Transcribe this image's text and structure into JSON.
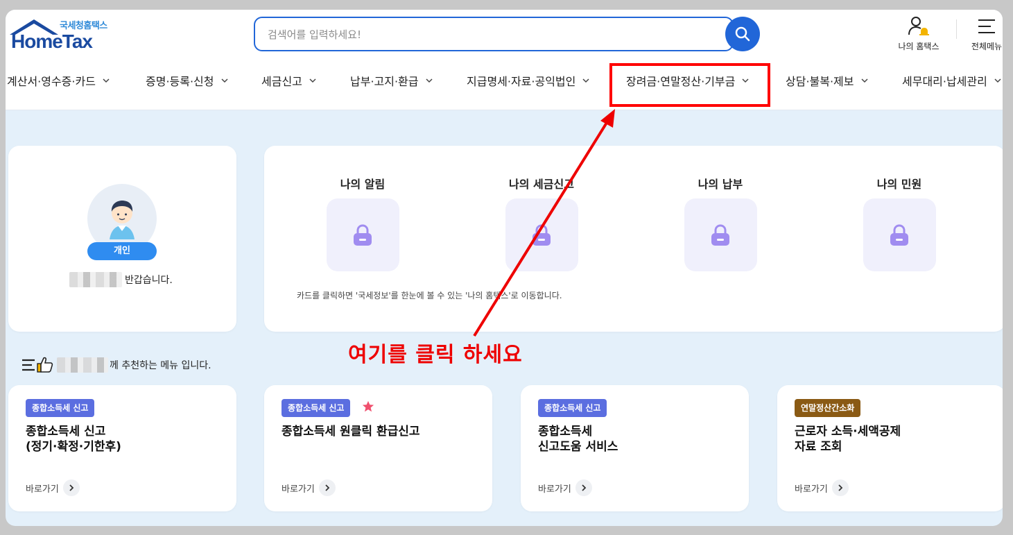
{
  "brand": {
    "small_text": "국세청홈택스",
    "name": "HomeTax"
  },
  "search": {
    "placeholder": "검색어를 입력하세요!"
  },
  "utility": {
    "my_hometax": "나의 홈택스",
    "all_menu": "전체메뉴"
  },
  "gnb": [
    {
      "label": "계산서·영수증·카드"
    },
    {
      "label": "증명·등록·신청"
    },
    {
      "label": "세금신고"
    },
    {
      "label": "납부·고지·환급"
    },
    {
      "label": "지급명세·자료·공익법인"
    },
    {
      "label": "장려금·연말정산·기부금"
    },
    {
      "label": "상담·불복·제보"
    },
    {
      "label": "세무대리·납세관리"
    }
  ],
  "profile": {
    "badge": "개인",
    "greeting": "반갑습니다."
  },
  "info_cards": {
    "items": [
      {
        "title": "나의 알림",
        "icon": "lock-icon"
      },
      {
        "title": "나의 세금신고",
        "icon": "lock-icon"
      },
      {
        "title": "나의 납부",
        "icon": "lock-icon"
      },
      {
        "title": "나의 민원",
        "icon": "lock-icon"
      }
    ],
    "note": "카드를 클릭하면 '국세정보'를 한눈에 볼 수 있는 '나의 홈택스'로 이동합니다."
  },
  "annotation": {
    "text": "여기를 클릭 하세요",
    "color": "#ee0000"
  },
  "recommend": {
    "heading_suffix": "께 추천하는 메뉴 입니다."
  },
  "menu_cards": [
    {
      "tag": "종합소득세 신고",
      "tag_color": "#5b6ee0",
      "title": "종합소득세 신고\n(정기·확정·기한후)",
      "go": "바로가기",
      "starred": false
    },
    {
      "tag": "종합소득세 신고",
      "tag_color": "#5b6ee0",
      "title": "종합소득세 원클릭 환급신고",
      "go": "바로가기",
      "starred": true
    },
    {
      "tag": "종합소득세 신고",
      "tag_color": "#5b6ee0",
      "title": "종합소득세\n신고도움 서비스",
      "go": "바로가기",
      "starred": false
    },
    {
      "tag": "연말정산간소화",
      "tag_color": "#8a5a14",
      "title": "근로자 소득·세액공제\n자료 조회",
      "go": "바로가기",
      "starred": false
    }
  ],
  "colors": {
    "primary": "#2166d8",
    "brand_navy": "#1a4aa0",
    "highlight": "#ff0000",
    "lock": "#a08cf0"
  }
}
